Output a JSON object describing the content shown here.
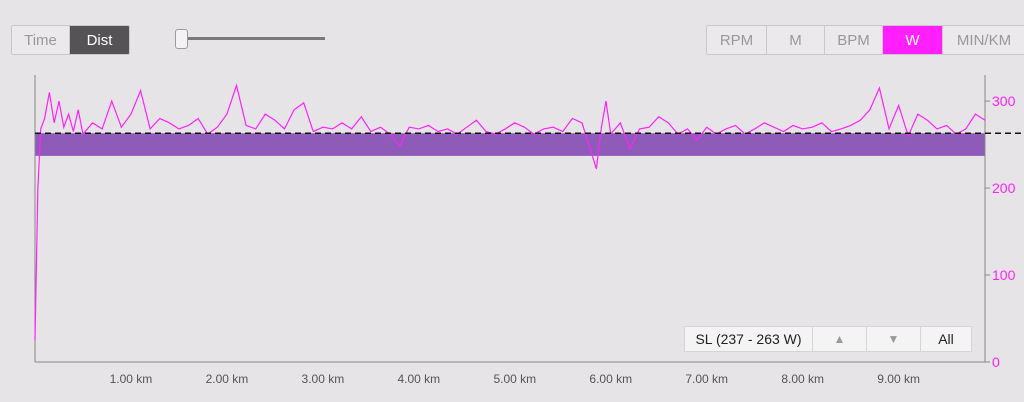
{
  "toggle": {
    "time_label": "Time",
    "dist_label": "Dist",
    "selected": "Dist"
  },
  "slider": {
    "value": 0.0
  },
  "metrics": {
    "buttons": [
      "RPM",
      "M",
      "BPM",
      "W",
      "MIN/KM"
    ],
    "selected": "W"
  },
  "colors": {
    "power_line": "#ff22ff",
    "zone_band": "#8e5cb8",
    "active_button": "#ff1fff",
    "axis_right": "#ff22ff"
  },
  "zone_bar": {
    "label": "SL (237 - 263 W)",
    "up_icon": "up-arrow-icon",
    "down_icon": "down-arrow-icon",
    "all_label": "All"
  },
  "chart_data": {
    "type": "line",
    "x_unit": "km",
    "x_ticks": [
      "1.00 km",
      "2.00 km",
      "3.00 km",
      "4.00 km",
      "5.00 km",
      "6.00 km",
      "7.00 km",
      "8.00 km",
      "9.00 km"
    ],
    "y_ticks": [
      "0",
      "100",
      "200",
      "300"
    ],
    "xlim": [
      0,
      9.9
    ],
    "ylim": [
      0,
      330
    ],
    "y_axis_side": "right",
    "reference_line": {
      "value": 263,
      "style": "dashed"
    },
    "zone_band": [
      237,
      263
    ],
    "series": [
      {
        "x": [
          0,
          0.03,
          0.06,
          0.1,
          0.15,
          0.2,
          0.25,
          0.3,
          0.35,
          0.4,
          0.45,
          0.5,
          0.6,
          0.7,
          0.8,
          0.9,
          1.0,
          1.1,
          1.2,
          1.3,
          1.4,
          1.5,
          1.6,
          1.7,
          1.8,
          1.9,
          2.0,
          2.1,
          2.2,
          2.3,
          2.4,
          2.5,
          2.6,
          2.7,
          2.8,
          2.9,
          3.0,
          3.1,
          3.2,
          3.3,
          3.4,
          3.5,
          3.6,
          3.7,
          3.8,
          3.9,
          4.0,
          4.1,
          4.2,
          4.3,
          4.4,
          4.5,
          4.6,
          4.7,
          4.8,
          4.9,
          5.0,
          5.1,
          5.2,
          5.3,
          5.4,
          5.5,
          5.6,
          5.7,
          5.8,
          5.85,
          5.9,
          5.95,
          6.0,
          6.1,
          6.2,
          6.3,
          6.4,
          6.5,
          6.6,
          6.7,
          6.8,
          6.9,
          7.0,
          7.1,
          7.2,
          7.3,
          7.4,
          7.5,
          7.6,
          7.7,
          7.8,
          7.9,
          8.0,
          8.1,
          8.2,
          8.3,
          8.4,
          8.5,
          8.6,
          8.7,
          8.8,
          8.9,
          9.0,
          9.1,
          9.2,
          9.3,
          9.4,
          9.5,
          9.6,
          9.7,
          9.8,
          9.9
        ],
        "y": [
          25,
          200,
          268,
          280,
          310,
          275,
          300,
          270,
          285,
          265,
          290,
          262,
          275,
          268,
          300,
          270,
          285,
          312,
          268,
          280,
          275,
          268,
          272,
          280,
          262,
          270,
          285,
          318,
          272,
          268,
          285,
          278,
          268,
          290,
          298,
          265,
          270,
          268,
          275,
          268,
          282,
          265,
          270,
          262,
          248,
          270,
          268,
          272,
          265,
          268,
          262,
          270,
          278,
          265,
          262,
          268,
          275,
          270,
          262,
          268,
          270,
          265,
          280,
          275,
          240,
          222,
          268,
          300,
          262,
          275,
          245,
          268,
          270,
          282,
          275,
          262,
          268,
          255,
          270,
          262,
          268,
          272,
          262,
          268,
          275,
          270,
          265,
          272,
          268,
          270,
          275,
          265,
          268,
          272,
          278,
          290,
          315,
          268,
          295,
          260,
          285,
          278,
          268,
          272,
          262,
          268,
          285,
          278
        ]
      }
    ]
  }
}
